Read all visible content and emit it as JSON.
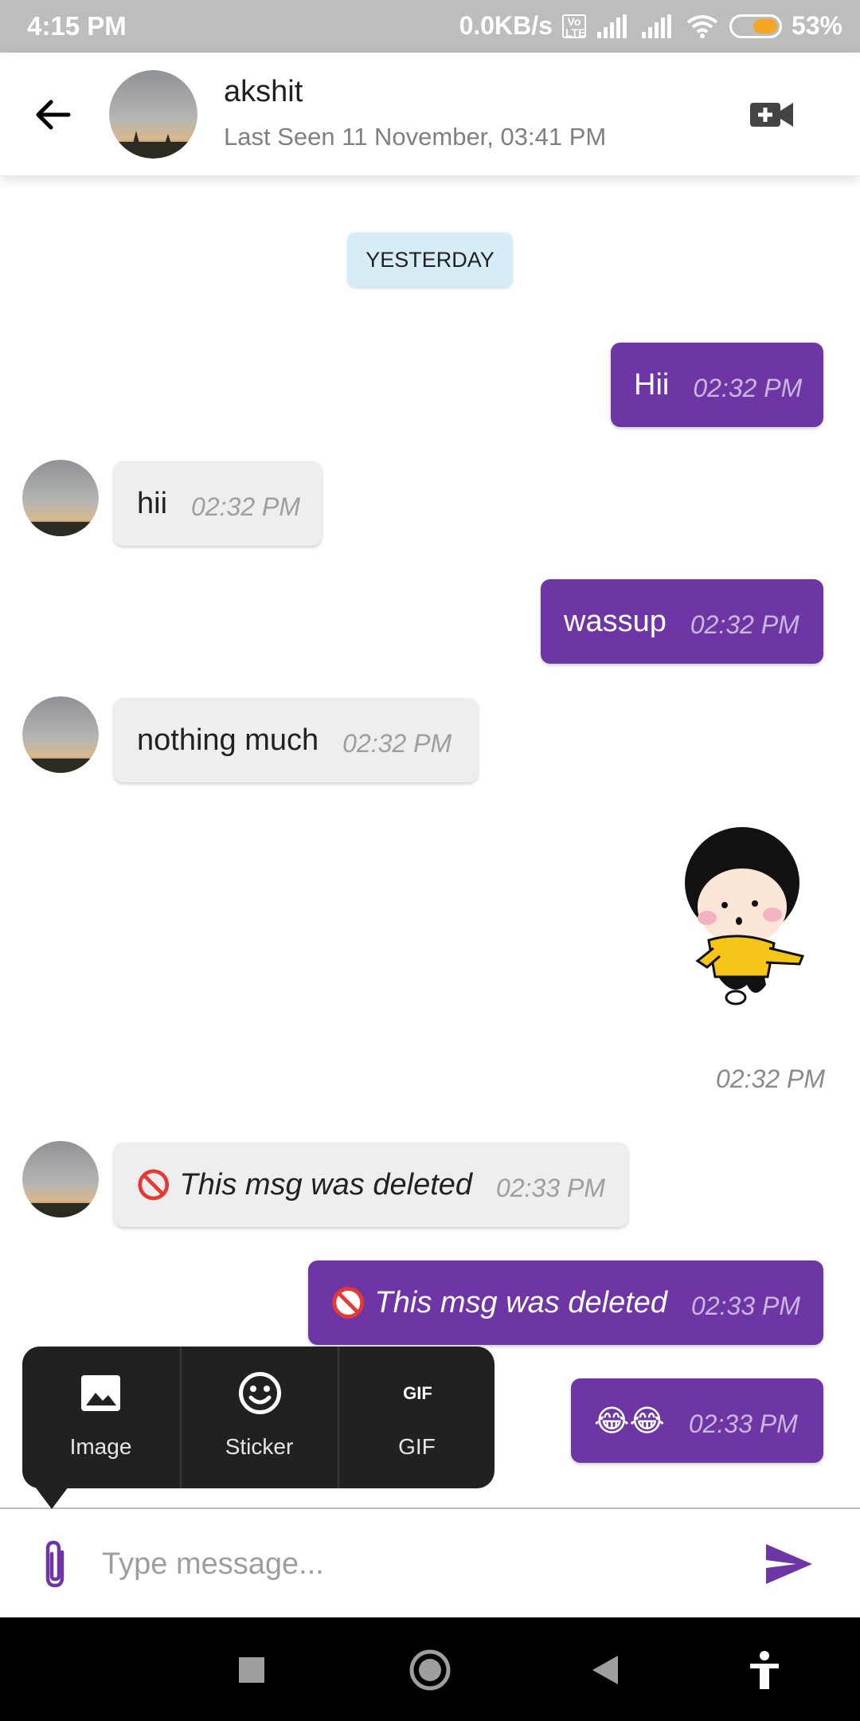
{
  "status_bar": {
    "time": "4:15 PM",
    "network_speed": "0.0KB/s",
    "volte": "Vo LTE",
    "battery": "53%",
    "battery_level": 0.53
  },
  "header": {
    "contact_name": "akshit",
    "last_seen": "Last Seen 11 November, 03:41 PM",
    "back_icon": "arrow-left-icon",
    "video_icon": "video-call-add-icon"
  },
  "date_chip": "YESTERDAY",
  "messages": [
    {
      "direction": "out",
      "text": "Hii",
      "time": "02:32 PM"
    },
    {
      "direction": "in",
      "text": "hii",
      "time": "02:32 PM"
    },
    {
      "direction": "out",
      "text": "wassup",
      "time": "02:32 PM"
    },
    {
      "direction": "in",
      "text": "nothing much",
      "time": "02:32 PM"
    },
    {
      "direction": "out",
      "type": "sticker",
      "time": "02:32 PM"
    },
    {
      "direction": "in",
      "text": "This msg was deleted",
      "time": "02:33 PM",
      "deleted": true
    },
    {
      "direction": "out",
      "text": "This msg was deleted",
      "time": "02:33 PM",
      "deleted": true
    },
    {
      "direction": "out",
      "text": "😂😂",
      "time": "02:33 PM"
    }
  ],
  "attach_menu": {
    "items": [
      {
        "label": "Image",
        "icon": "image-icon"
      },
      {
        "label": "Sticker",
        "icon": "smiley-icon"
      },
      {
        "label": "GIF",
        "icon": "gif-icon"
      }
    ]
  },
  "composer": {
    "placeholder": "Type message...",
    "value": ""
  },
  "colors": {
    "outgoing_bubble": "#6e35a5",
    "incoming_bubble": "#eeeeee",
    "date_chip": "#d6ecf7",
    "status_bar": "#bdbdbd"
  }
}
